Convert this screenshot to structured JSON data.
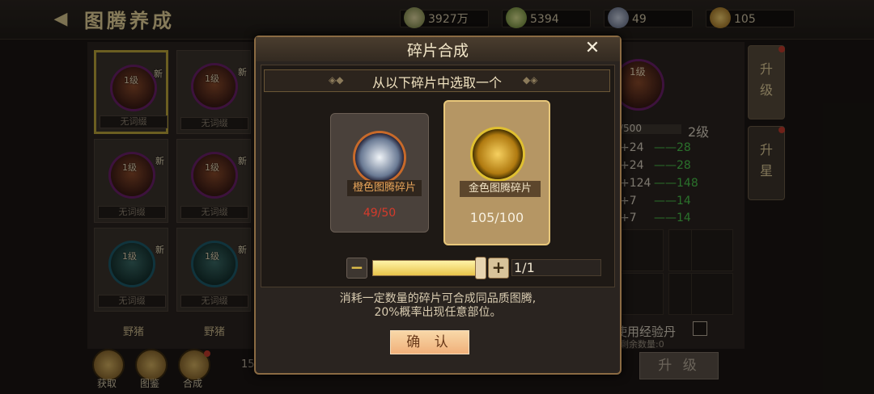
{
  "topbar": {
    "back_icon": "back-arrow-icon",
    "title": "图腾养成",
    "resources": [
      {
        "icon": "silver-ingot-icon",
        "value": "3927万"
      },
      {
        "icon": "jade-ingot-icon",
        "value": "5394"
      },
      {
        "icon": "dragon-icon",
        "value": "49"
      },
      {
        "icon": "gold-ingot-icon",
        "value": "105"
      }
    ]
  },
  "grid": {
    "level_text": "1级",
    "new_badge": "新",
    "no_attr": "无词缀",
    "name": "野猪"
  },
  "bottom_left": {
    "labels": [
      "获取",
      "图鉴",
      "合成"
    ],
    "count": "15"
  },
  "right_panel": {
    "tab_upgrade": "升级",
    "tab_star": "升星",
    "level_label": "2级",
    "exp_text": "/500",
    "stats": [
      {
        "value": "+24",
        "gain": "28"
      },
      {
        "value": "+24",
        "gain": "28"
      },
      {
        "value": "+124",
        "gain": "148"
      },
      {
        "value": "+7",
        "gain": "14"
      },
      {
        "value": "+7",
        "gain": "14"
      }
    ],
    "use_exp_label": "使用经验丹",
    "remaining_label": "剩余数量:0",
    "upgrade_button": "升 级"
  },
  "modal": {
    "title": "碎片合成",
    "close_icon": "close-icon",
    "subtitle": "从以下碎片中选取一个",
    "fragments": [
      {
        "name": "橙色图腾碎片",
        "count": "49/50",
        "color": "#d63a2b"
      },
      {
        "name": "金色图腾碎片",
        "count": "105/100",
        "color": "#f7f0e0"
      }
    ],
    "quantity": "1/1",
    "slider_fraction": 1.0,
    "description_line1": "消耗一定数量的碎片可合成同品质图腾,",
    "description_line2": "20%概率出现任意部位。",
    "confirm": "确 认"
  }
}
